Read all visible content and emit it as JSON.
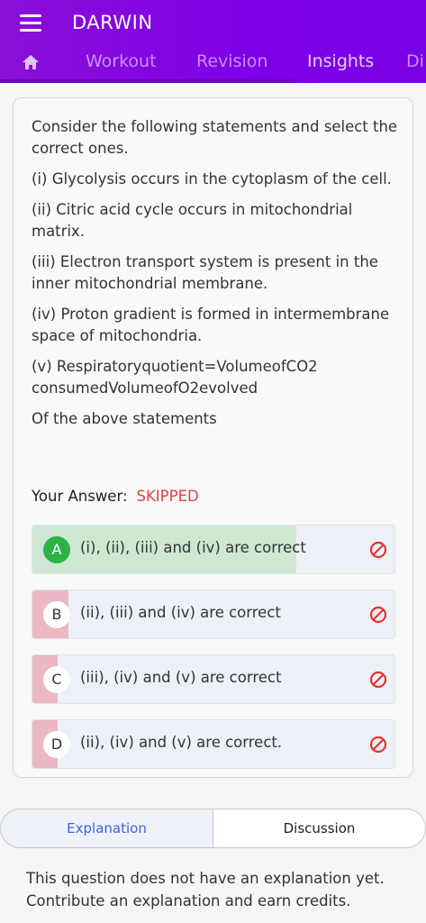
{
  "header": {
    "title": "DARWIN",
    "tabs": [
      "Workout",
      "Revision",
      "Insights",
      "Di"
    ],
    "active_tab_index": 2
  },
  "question": {
    "lines": [
      "Consider the following statements and select the correct ones.",
      "(i) Glycolysis occurs in the cytoplasm of the cell.",
      "(ii) Citric acid cycle occurs in mitochondrial matrix.",
      "(iii) Electron transport system is present in the inner mitochondrial membrane.",
      "(iv) Proton gradient is formed in intermembrane space of mitochondria.",
      "(v) Respiratoryquotient=VolumeofCO2 consumedVolumeofO2evolved",
      "Of the above statements"
    ]
  },
  "answer": {
    "label": "Your Answer:",
    "value": "SKIPPED"
  },
  "options": [
    {
      "letter": "A",
      "text": "(i), (ii), (iii) and (iv) are correct",
      "percent": 73,
      "correct": true
    },
    {
      "letter": "B",
      "text": "(ii), (iii) and (iv) are correct",
      "percent": 10,
      "correct": false
    },
    {
      "letter": "C",
      "text": "(iii), (iv) and (v) are correct",
      "percent": 7,
      "correct": false
    },
    {
      "letter": "D",
      "text": "(ii), (iv) and (v) are correct.",
      "percent": 7,
      "correct": false
    }
  ],
  "colors": {
    "header": "#7e00e8",
    "correct_bar": "#cde8d2",
    "correct_circle": "#2db24a",
    "wrong_bar": "#ecb8c4",
    "skipped": "#e0453e",
    "ban_icon": "#e2352f",
    "link_blue": "#3b62d8"
  },
  "explanation_tabs": {
    "explanation": "Explanation",
    "discussion": "Discussion"
  },
  "no_explanation_text": "This question does not have an explanation yet. Contribute an explanation and earn credits."
}
